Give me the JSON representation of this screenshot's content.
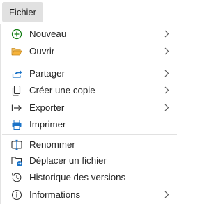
{
  "menubar": {
    "tab_label": "Fichier"
  },
  "menu": {
    "groups": [
      [
        {
          "label": "Nouveau",
          "icon": "add-circle-icon",
          "submenu": true
        },
        {
          "label": "Ouvrir",
          "icon": "folder-open-icon",
          "submenu": true
        }
      ],
      [
        {
          "label": "Partager",
          "icon": "share-icon",
          "submenu": true
        },
        {
          "label": "Créer une copie",
          "icon": "copy-icon",
          "submenu": true
        },
        {
          "label": "Exporter",
          "icon": "export-arrow-icon",
          "submenu": true
        },
        {
          "label": "Imprimer",
          "icon": "printer-icon",
          "submenu": false
        }
      ],
      [
        {
          "label": "Renommer",
          "icon": "rename-icon",
          "submenu": false
        },
        {
          "label": "Déplacer un fichier",
          "icon": "move-file-icon",
          "submenu": false
        },
        {
          "label": "Historique des versions",
          "icon": "history-icon",
          "submenu": false
        },
        {
          "label": "Informations",
          "icon": "info-icon",
          "submenu": true
        }
      ]
    ]
  },
  "colors": {
    "accent_blue": "#1a73c8",
    "add_green": "#107c10",
    "folder_orange": "#e8a33d",
    "text": "#242424",
    "chevron": "#5a5a5a"
  }
}
